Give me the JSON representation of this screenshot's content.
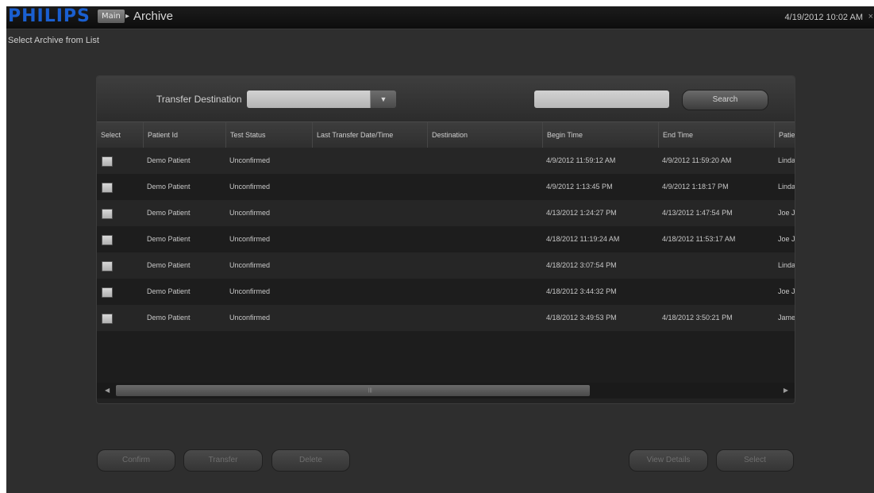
{
  "header": {
    "logo": "PHILIPS",
    "breadcrumb_main": "Main",
    "breadcrumb_separator": "▸",
    "breadcrumb_current": "Archive",
    "datetime": "4/19/2012 10:02 AM",
    "close_glyph": "×"
  },
  "page": {
    "subtitle": "Select Archive from List"
  },
  "filters": {
    "destination_label": "Transfer Destination",
    "destination_value": "",
    "destination_arrow": "▼",
    "search_value": "",
    "search_label": "Search"
  },
  "table": {
    "columns": [
      "Select",
      "Patient Id",
      "Test Status",
      "Last Transfer Date/Time",
      "Destination",
      "Begin Time",
      "End Time",
      "Patient"
    ],
    "rows": [
      {
        "checked": false,
        "patient_id": "Demo Patient",
        "status": "Unconfirmed",
        "last_transfer": "",
        "destination": "",
        "begin": "4/9/2012 11:59:12 AM",
        "end": "4/9/2012 11:59:20 AM",
        "patient": "Linda"
      },
      {
        "checked": false,
        "patient_id": "Demo Patient",
        "status": "Unconfirmed",
        "last_transfer": "",
        "destination": "",
        "begin": "4/9/2012 1:13:45 PM",
        "end": "4/9/2012 1:18:17 PM",
        "patient": "Linda"
      },
      {
        "checked": false,
        "patient_id": "Demo Patient",
        "status": "Unconfirmed",
        "last_transfer": "",
        "destination": "",
        "begin": "4/13/2012 1:24:27 PM",
        "end": "4/13/2012 1:47:54 PM",
        "patient": "Joe Jo"
      },
      {
        "checked": false,
        "patient_id": "Demo Patient",
        "status": "Unconfirmed",
        "last_transfer": "",
        "destination": "",
        "begin": "4/18/2012 11:19:24 AM",
        "end": "4/18/2012 11:53:17 AM",
        "patient": "Joe Jo"
      },
      {
        "checked": false,
        "patient_id": "Demo Patient",
        "status": "Unconfirmed",
        "last_transfer": "",
        "destination": "",
        "begin": "4/18/2012 3:07:54 PM",
        "end": "",
        "patient": "Linda"
      },
      {
        "checked": false,
        "patient_id": "Demo Patient",
        "status": "Unconfirmed",
        "last_transfer": "",
        "destination": "",
        "begin": "4/18/2012 3:44:32 PM",
        "end": "",
        "patient": "Joe Jo"
      },
      {
        "checked": false,
        "patient_id": "Demo Patient",
        "status": "Unconfirmed",
        "last_transfer": "",
        "destination": "",
        "begin": "4/18/2012 3:49:53 PM",
        "end": "4/18/2012 3:50:21 PM",
        "patient": "James"
      }
    ],
    "scroll_left": "◀",
    "scroll_right": "▶",
    "scroll_grip": "|||"
  },
  "footer": {
    "confirm_label": "Confirm",
    "transfer_label": "Transfer",
    "delete_label": "Delete",
    "view_details_label": "View Details",
    "select_label": "Select"
  },
  "colors": {
    "logo_blue": "#1a5fd0",
    "background": "#2e2e2e",
    "disabled_text": "#6e6e6e"
  }
}
